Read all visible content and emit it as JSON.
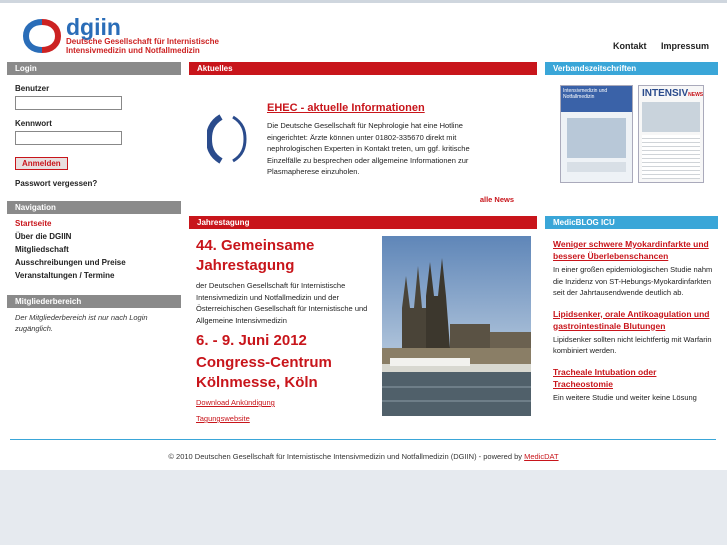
{
  "header": {
    "logo_text": "dgiin",
    "logo_subtitle": "Deutsche Gesellschaft für Internistische Intensivmedizin und Notfallmedizin",
    "nav": [
      "Kontakt",
      "Impressum"
    ]
  },
  "login": {
    "title": "Login",
    "user_label": "Benutzer",
    "pass_label": "Kennwort",
    "submit": "Anmelden",
    "forgot": "Passwort vergessen?"
  },
  "navigation": {
    "title": "Navigation",
    "items": [
      "Startseite",
      "Über die DGIIN",
      "Mitgliedschaft",
      "Ausschreibungen und Preise",
      "Veranstaltungen / Termine"
    ]
  },
  "members": {
    "title": "Mitgliederbereich",
    "text": "Der Mitgliederbereich ist nur nach Login zugänglich."
  },
  "news": {
    "title": "Aktuelles",
    "headline": "EHEC - aktuelle Informationen",
    "text": "Die Deutsche Gesellschaft für Nephrologie hat eine Hotline eingerichtet: Ärzte können unter 01802-335670 direkt mit nephrologischen Experten in Kontakt treten, um ggf. kritische Einzelfälle zu besprechen oder allgemeine Informationen zur Plasmapherese einzuholen.",
    "all_link": "alle News"
  },
  "meeting": {
    "title": "Jahrestagung",
    "headline": "44. Gemeinsame Jahrestagung",
    "text": "der Deutschen Gesellschaft für Internistische Intensivmedizin und Notfallmedizin und der Österreichischen Gesellschaft für Internistische und Allgemeine Intensivmedizin",
    "date": "6. - 9. Juni 2012",
    "venue": "Congress-Centrum Kölnmesse, Köln",
    "link1": "Download Ankündigung",
    "link2": "Tagungswebsite"
  },
  "journals": {
    "title": "Verbandszeitschriften",
    "cover1_title": "Intensivmedizin und Notfallmedizin",
    "cover2_title": "INTENSIV",
    "cover2_tag": "NEWS"
  },
  "blog": {
    "title": "MedicBLOG ICU",
    "items": [
      {
        "title": "Weniger schwere Myokardinfarkte und bessere Überlebenschancen",
        "text": "In einer großen epidemiologischen Studie nahm die Inzidenz von ST-Hebungs-Myokardinfarkten seit der Jahrtausendwende deutlich ab."
      },
      {
        "title": "Lipidsenker, orale Antikoagulation und gastrointestinale Blutungen",
        "text": "Lipidsenker sollten nicht leichtfertig mit Warfarin kombiniert werden."
      },
      {
        "title": "Tracheale Intubation oder Tracheostomie",
        "text": "Ein weitere Studie und weiter keine Lösung"
      }
    ]
  },
  "footer": {
    "text": "© 2010 Deutschen Gesellschaft für Internistische Intensivmedizin und Notfallmedizin (DGIIN) - powered by",
    "link": "MedicDAT"
  },
  "colors": {
    "red": "#c8151b",
    "blue": "#3aa6d8",
    "gray": "#8a8a8a"
  }
}
